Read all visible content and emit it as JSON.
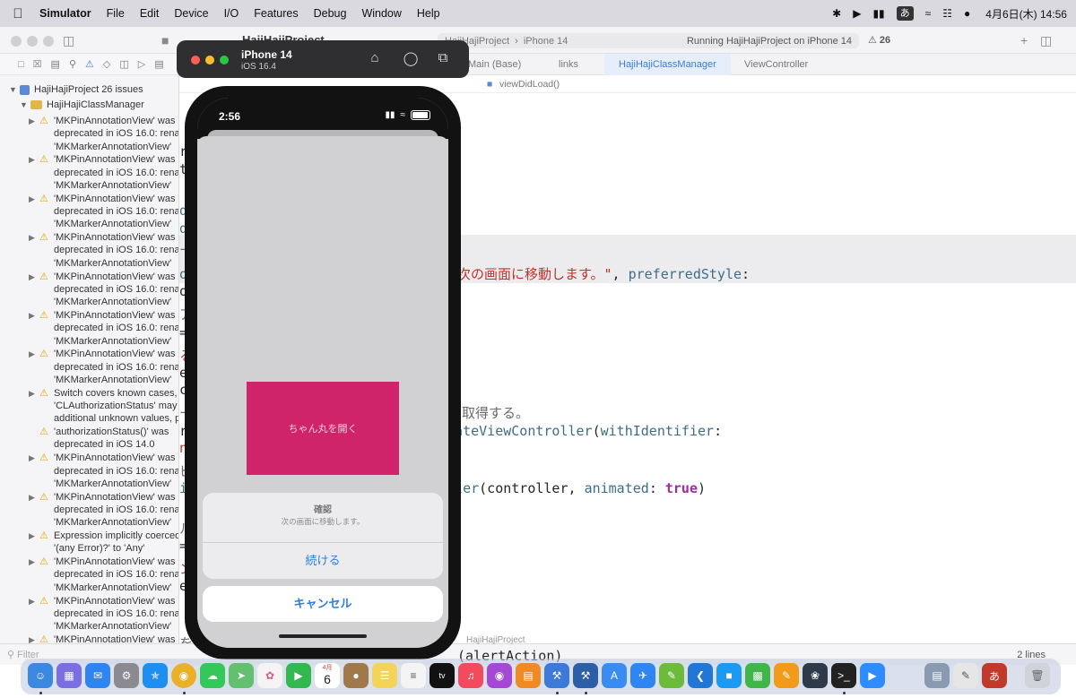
{
  "menubar": {
    "app": "Simulator",
    "items": [
      "File",
      "Edit",
      "Device",
      "I/O",
      "Features",
      "Debug",
      "Window",
      "Help"
    ],
    "ime_indicator": "あ",
    "clock": "4月6日(木) 14:56"
  },
  "xcode": {
    "project_title": "HajiHajiProject",
    "scheme_target": "HajiHajiProject",
    "scheme_device": "iPhone 14",
    "run_status": "Running HajiHajiProject on iPhone 14",
    "issue_count": "26",
    "tabs": [
      "Main (Base)",
      "links",
      "HajiHajiClassManager",
      "ViewController"
    ],
    "jumpbar": [
      "viewDidLoad()"
    ],
    "sidebar_project": "HajiHajiProject 26 issues",
    "sidebar_group": "HajiHajiClassManager",
    "issues": [
      "'MKPinAnnotationView' was\ndeprecated in iOS 16.0: renam\n'MKMarkerAnnotationView'",
      "'MKPinAnnotationView' was\ndeprecated in iOS 16.0: renam\n'MKMarkerAnnotationView'",
      "'MKPinAnnotationView' was\ndeprecated in iOS 16.0: renam\n'MKMarkerAnnotationView'",
      "'MKPinAnnotationView' was\ndeprecated in iOS 16.0: renam\n'MKMarkerAnnotationView'",
      "'MKPinAnnotationView' was\ndeprecated in iOS 16.0: renam\n'MKMarkerAnnotationView'",
      "'MKPinAnnotationView' was\ndeprecated in iOS 16.0: renam\n'MKMarkerAnnotationView'",
      "'MKPinAnnotationView' was\ndeprecated in iOS 16.0: renam\n'MKMarkerAnnotationView'",
      "Switch covers known cases, b\n'CLAuthorizationStatus' may h\nadditional unknown values, po",
      "'authorizationStatus()' was\ndeprecated in iOS 14.0",
      "'MKPinAnnotationView' was\ndeprecated in iOS 16.0: renam\n'MKMarkerAnnotationView'",
      "'MKPinAnnotationView' was\ndeprecated in iOS 16.0: renam\n'MKMarkerAnnotationView'",
      "Expression implicitly coerced f\n'(any Error)?' to 'Any'",
      "'MKPinAnnotationView' was\ndeprecated in iOS 16.0: renam\n'MKMarkerAnnotationView'",
      "'MKPinAnnotationView' was\ndeprecated in iOS 16.0: renam\n'MKMarkerAnnotationView'",
      "'MKPinAnnotationView' was\ndeprecated in iOS 16.0: renam\n'MKMarkerAnnotationView'",
      "'MKPinAnnotationView' was"
    ],
    "filter_placeholder": "Filter",
    "status_lines": "2 lines",
    "status_project": "HajiHajiProject"
  },
  "simulator": {
    "device": "iPhone 14",
    "os": "iOS 16.4",
    "time": "2:56",
    "open_button": "ちゃん丸を開く",
    "alert_title": "確認",
    "alert_message": "次の画面に移動します。",
    "continue_action": "続ける",
    "cancel_action": "キャンセル"
  },
  "dock": {
    "calendar_month": "4月",
    "calendar_day": "6"
  }
}
